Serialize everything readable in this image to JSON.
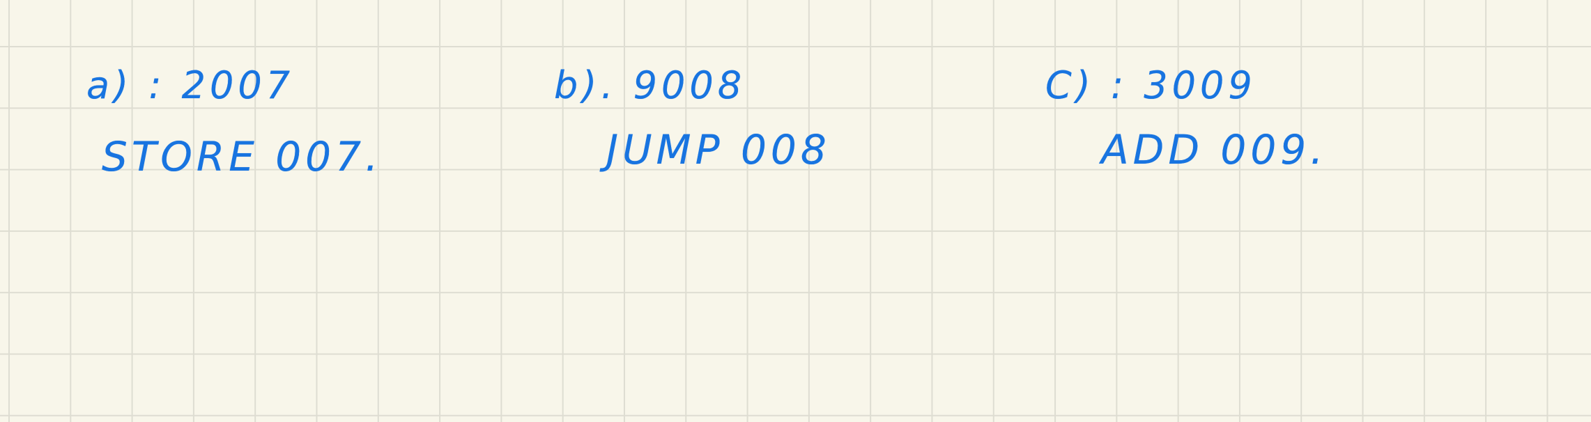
{
  "answers": [
    {
      "label_value": "a) : 2007",
      "instruction": "STORE 007."
    },
    {
      "label_value": "b). 9008",
      "instruction": "JUMP 008"
    },
    {
      "label_value": "C) : 3009",
      "instruction": "ADD 009."
    }
  ]
}
